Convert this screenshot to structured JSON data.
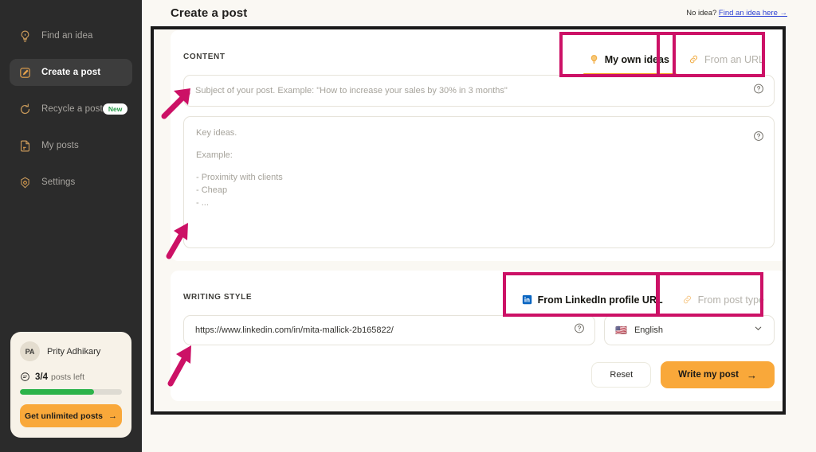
{
  "sidebar": {
    "items": [
      {
        "label": "Find an idea",
        "icon": "lightbulb-icon",
        "active": false,
        "badge": ""
      },
      {
        "label": "Create a post",
        "icon": "pencil-icon",
        "active": true,
        "badge": ""
      },
      {
        "label": "Recycle a post",
        "icon": "recycle-icon",
        "active": false,
        "badge": "New"
      },
      {
        "label": "My posts",
        "icon": "document-icon",
        "active": false,
        "badge": ""
      },
      {
        "label": "Settings",
        "icon": "gear-icon",
        "active": false,
        "badge": ""
      }
    ],
    "user": {
      "initials": "PA",
      "name": "Prity Adhikary",
      "quota_count": "3/4",
      "quota_label": "posts left",
      "progress_percent": 73,
      "upgrade_label": "Get unlimited posts",
      "upgrade_arrow": "→"
    }
  },
  "header": {
    "title": "Create a post",
    "hint_prefix": "No idea?",
    "hint_link": "Find an idea here →"
  },
  "content_section": {
    "title": "CONTENT",
    "tabs": [
      {
        "label": "My own ideas",
        "icon": "lightbulb-icon",
        "active": true
      },
      {
        "label": "From an URL",
        "icon": "link-icon",
        "active": false
      }
    ],
    "subject_placeholder": "Subject of your post. Example: \"How to increase your sales by 30% in 3 months\"",
    "keyideas_lines": [
      "Key ideas.",
      "",
      "Example:",
      "",
      "- Proximity with clients",
      "- Cheap",
      "- ..."
    ],
    "help_icon": "question-mark-icon"
  },
  "style_section": {
    "title": "WRITING STYLE",
    "tabs": [
      {
        "label": "From LinkedIn profile URL",
        "icon": "linkedin-icon",
        "active": true
      },
      {
        "label": "From post type",
        "icon": "link-icon",
        "active": false
      }
    ],
    "url_value": "https://www.linkedin.com/in/mita-mallick-2b165822/",
    "language_flag": "🇺🇸",
    "language_value": "English",
    "chevron": "chevron-down-icon"
  },
  "actions": {
    "reset_label": "Reset",
    "write_label": "Write my post",
    "write_arrow": "→"
  },
  "annotations": {
    "highlight_color": "#cc1166",
    "frame_color": "#1a1a1a"
  }
}
